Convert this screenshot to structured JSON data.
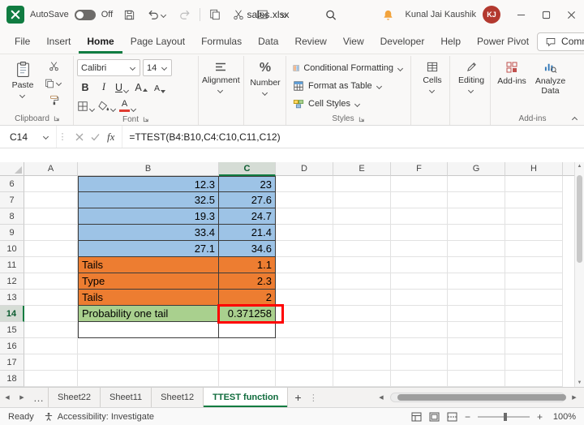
{
  "window": {
    "file_name": "sales.xlsx",
    "user_name": "Kunal Jai Kaushik",
    "user_initials": "KJ",
    "autosave_label": "AutoSave",
    "autosave_state": "Off"
  },
  "menu_bar": {
    "tabs": [
      "File",
      "Insert",
      "Home",
      "Page Layout",
      "Formulas",
      "Data",
      "Review",
      "View",
      "Developer",
      "Help",
      "Power Pivot"
    ],
    "active_tab": "Home",
    "comments_label": "Comments"
  },
  "ribbon": {
    "paste_label": "Paste",
    "font_name": "Calibri",
    "font_size": "14",
    "bold_label": "B",
    "italic_label": "I",
    "underline_label": "U",
    "font_letter": "A",
    "percent_glyph": "%",
    "alignment_label": "Alignment",
    "number_label": "Number",
    "styles_items": [
      "Conditional Formatting",
      "Format as Table",
      "Cell Styles"
    ],
    "cells_label": "Cells",
    "editing_label": "Editing",
    "addins_label": "Add-ins",
    "analyze_label": "Analyze Data",
    "group_labels": {
      "clipboard": "Clipboard",
      "font": "Font",
      "styles": "Styles",
      "addins": "Add-ins"
    }
  },
  "formula_bar": {
    "name_box": "C14",
    "fx_label": "fx",
    "formula": "=TTEST(B4:B10,C4:C10,C11,C12)"
  },
  "grid": {
    "columns": [
      "A",
      "B",
      "C",
      "D",
      "E",
      "F",
      "G",
      "H"
    ],
    "selected_column": "C",
    "selected_row": 14,
    "rows": [
      {
        "n": 6,
        "B": "12.3",
        "C": "23",
        "style": "blue"
      },
      {
        "n": 7,
        "B": "32.5",
        "C": "27.6",
        "style": "blue"
      },
      {
        "n": 8,
        "B": "19.3",
        "C": "24.7",
        "style": "blue"
      },
      {
        "n": 9,
        "B": "33.4",
        "C": "21.4",
        "style": "blue"
      },
      {
        "n": 10,
        "B": "27.1",
        "C": "34.6",
        "style": "blue"
      },
      {
        "n": 11,
        "B": "Tails",
        "C": "1.1",
        "style": "orange"
      },
      {
        "n": 12,
        "B": "Type",
        "C": "2.3",
        "style": "orange"
      },
      {
        "n": 13,
        "B": "Tails",
        "C": "2",
        "style": "orange"
      },
      {
        "n": 14,
        "B": "Probability one tail",
        "C": "0.371258",
        "style": "green"
      },
      {
        "n": 15,
        "B": "",
        "C": "",
        "style": "plain"
      },
      {
        "n": 16
      },
      {
        "n": 17
      },
      {
        "n": 18
      }
    ],
    "cell_colors": {
      "blue": "#9DC3E6",
      "orange": "#ED7D31",
      "green": "#A9D08E"
    },
    "annotation_color": "#FF0000"
  },
  "sheet_bar": {
    "tabs": [
      "Sheet22",
      "Sheet11",
      "Sheet12",
      "TTEST function"
    ],
    "active_tab": "TTEST function"
  },
  "status_bar": {
    "mode": "Ready",
    "accessibility": "Accessibility: Investigate",
    "zoom_level": "100%"
  },
  "glyphs": {
    "ellipsis": "…",
    "more_commands": "»",
    "add_sheet": "+",
    "splitter": "⋮",
    "left_arrow": "◀",
    "right_arrow": "▶",
    "up_arrow": "▲",
    "down_arrow": "▼",
    "zoom_out": "−",
    "zoom_in": "+"
  },
  "colors": {
    "excel_green": "#107C41",
    "avatar": "#B3392F"
  }
}
